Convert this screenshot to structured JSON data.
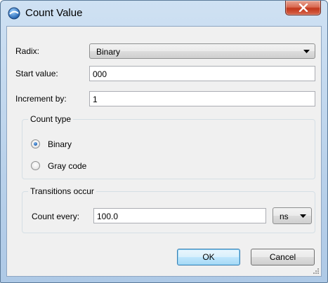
{
  "window": {
    "title": "Count Value",
    "icon": "app-globe-icon"
  },
  "colors": {
    "title_bar": "#b9d1ea",
    "close_button": "#c2361b",
    "client_background": "#f0f0f0",
    "default_button": "#bee6fd",
    "radio_selected": "#1b5fb0"
  },
  "form": {
    "radix": {
      "label": "Radix:",
      "value": "Binary"
    },
    "start_value": {
      "label": "Start value:",
      "value": "000"
    },
    "increment": {
      "label": "Increment by:",
      "value": "1"
    }
  },
  "count_type": {
    "legend": "Count type",
    "options": [
      {
        "label": "Binary",
        "selected": true
      },
      {
        "label": "Gray code",
        "selected": false
      }
    ]
  },
  "transitions": {
    "legend": "Transitions occur",
    "count_every_label": "Count every:",
    "count_every_value": "100.0",
    "unit": "ns"
  },
  "buttons": {
    "ok": "OK",
    "cancel": "Cancel"
  }
}
